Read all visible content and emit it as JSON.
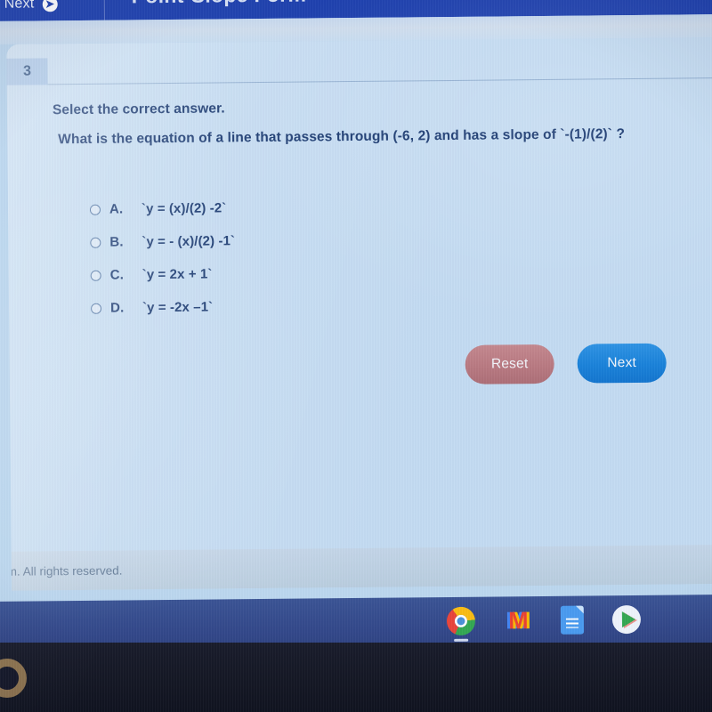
{
  "header": {
    "next_label": "Next",
    "next_arrow_icon": "arrow-right-circle-icon",
    "title": "Point-Slope Form"
  },
  "question": {
    "number": "3",
    "prompt": "Select the correct answer.",
    "text": "What is the equation of a line that passes through (-6, 2) and has a slope of `-(1)/(2)` ?",
    "options": [
      {
        "letter": "A.",
        "text": "`y = (x)/(2) -2`",
        "selected": false
      },
      {
        "letter": "B.",
        "text": "`y = - (x)/(2) -1`",
        "selected": false
      },
      {
        "letter": "C.",
        "text": "`y = 2x + 1`",
        "selected": false
      },
      {
        "letter": "D.",
        "text": "`y = -2x –1`",
        "selected": false
      }
    ]
  },
  "actions": {
    "reset_label": "Reset",
    "next_label": "Next",
    "reset_color": "#b97a82",
    "next_color": "#1a82da"
  },
  "footer": {
    "copyright": "ntum. All rights reserved."
  },
  "taskbar": {
    "icons": [
      {
        "name": "chrome-icon",
        "label": "Chrome"
      },
      {
        "name": "gmail-icon",
        "label": "M"
      },
      {
        "name": "google-docs-icon",
        "label": "Docs"
      },
      {
        "name": "play-store-icon",
        "label": "Play Store"
      }
    ]
  },
  "colors": {
    "header_blue": "#1c3fae",
    "page_blue": "#c3dbf2",
    "text_navy": "#10316b",
    "shelf_blue": "#33488a"
  }
}
